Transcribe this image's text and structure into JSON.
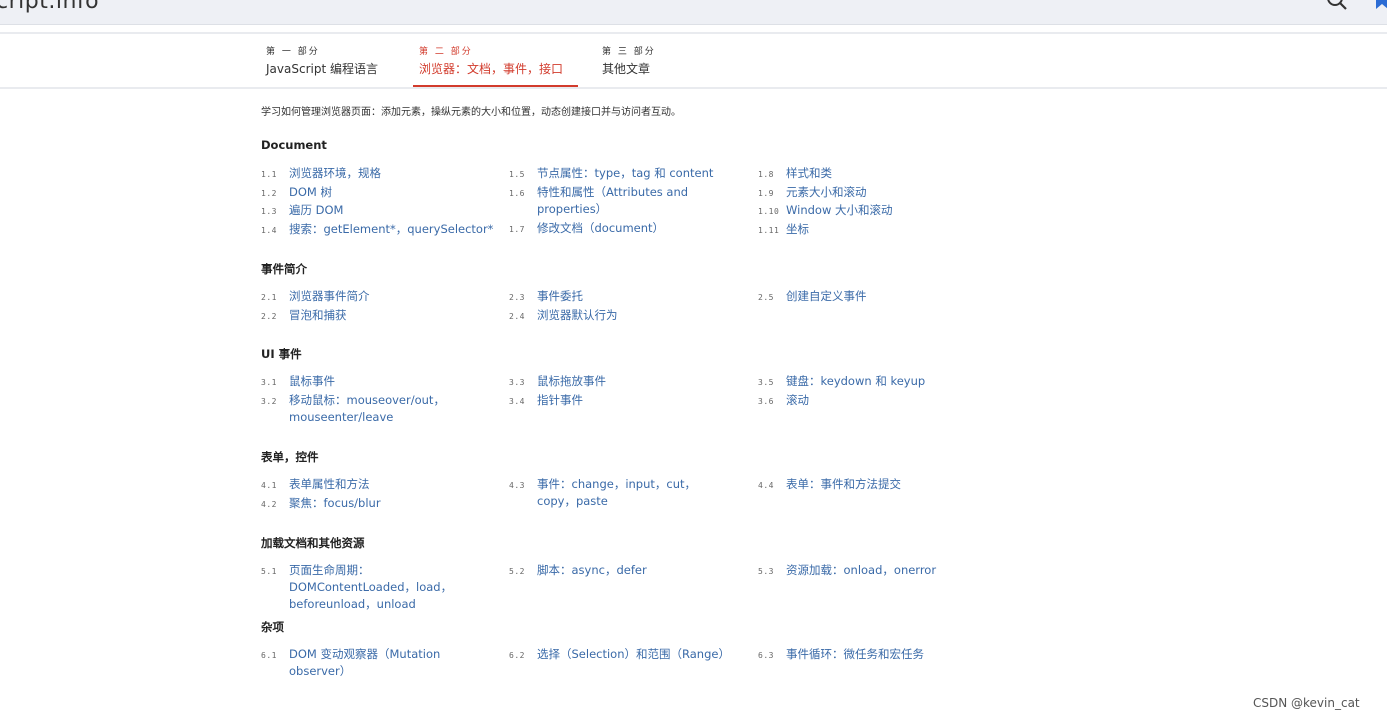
{
  "header": {
    "site_logo": "cript.info"
  },
  "tabs": [
    {
      "sub": "第 一 部分",
      "title": "JavaScript 编程语言",
      "active": false
    },
    {
      "sub": "第 二 部分",
      "title": "浏览器：文档，事件，接口",
      "active": true
    },
    {
      "sub": "第 三 部分",
      "title": "其他文章",
      "active": false
    }
  ],
  "intro": "学习如何管理浏览器页面：添加元素，操纵元素的大小和位置，动态创建接口并与访问者互动。",
  "sections": [
    {
      "title": "Document",
      "items": [
        {
          "num": "1.1",
          "label": "浏览器环境，规格"
        },
        {
          "num": "1.2",
          "label": "DOM 树"
        },
        {
          "num": "1.3",
          "label": "遍历 DOM"
        },
        {
          "num": "1.4",
          "label": "搜索：getElement*，querySelector*"
        },
        {
          "num": "1.5",
          "label": "节点属性：type，tag 和 content"
        },
        {
          "num": "1.6",
          "label": "特性和属性（Attributes and properties）"
        },
        {
          "num": "1.7",
          "label": "修改文档（document）"
        },
        {
          "num": "1.8",
          "label": "样式和类"
        },
        {
          "num": "1.9",
          "label": "元素大小和滚动"
        },
        {
          "num": "1.10",
          "label": "Window 大小和滚动"
        },
        {
          "num": "1.11",
          "label": "坐标"
        }
      ]
    },
    {
      "title": "事件简介",
      "items": [
        {
          "num": "2.1",
          "label": "浏览器事件简介"
        },
        {
          "num": "2.2",
          "label": "冒泡和捕获"
        },
        {
          "num": "2.3",
          "label": "事件委托"
        },
        {
          "num": "2.4",
          "label": "浏览器默认行为"
        },
        {
          "num": "2.5",
          "label": "创建自定义事件"
        }
      ]
    },
    {
      "title": "UI 事件",
      "items": [
        {
          "num": "3.1",
          "label": "鼠标事件"
        },
        {
          "num": "3.2",
          "label": "移动鼠标：mouseover/out，mouseenter/leave"
        },
        {
          "num": "3.3",
          "label": "鼠标拖放事件"
        },
        {
          "num": "3.4",
          "label": "指针事件"
        },
        {
          "num": "3.5",
          "label": "键盘：keydown 和 keyup"
        },
        {
          "num": "3.6",
          "label": "滚动"
        }
      ]
    },
    {
      "title": "表单，控件",
      "items": [
        {
          "num": "4.1",
          "label": "表单属性和方法"
        },
        {
          "num": "4.2",
          "label": "聚焦：focus/blur"
        },
        {
          "num": "4.3",
          "label": "事件：change，input，cut，copy，paste"
        },
        {
          "num": "4.4",
          "label": "表单：事件和方法提交"
        }
      ]
    },
    {
      "title": "加载文档和其他资源",
      "items": [
        {
          "num": "5.1",
          "label": "页面生命周期：DOMContentLoaded，load，beforeunload，unload"
        },
        {
          "num": "5.2",
          "label": "脚本：async，defer"
        },
        {
          "num": "5.3",
          "label": "资源加载：onload，onerror"
        }
      ]
    },
    {
      "title": "杂项",
      "items": [
        {
          "num": "6.1",
          "label": "DOM 变动观察器（Mutation observer）"
        },
        {
          "num": "6.2",
          "label": "选择（Selection）和范围（Range）"
        },
        {
          "num": "6.3",
          "label": "事件循环：微任务和宏任务"
        }
      ]
    }
  ],
  "watermark": "CSDN @kevin_cat"
}
